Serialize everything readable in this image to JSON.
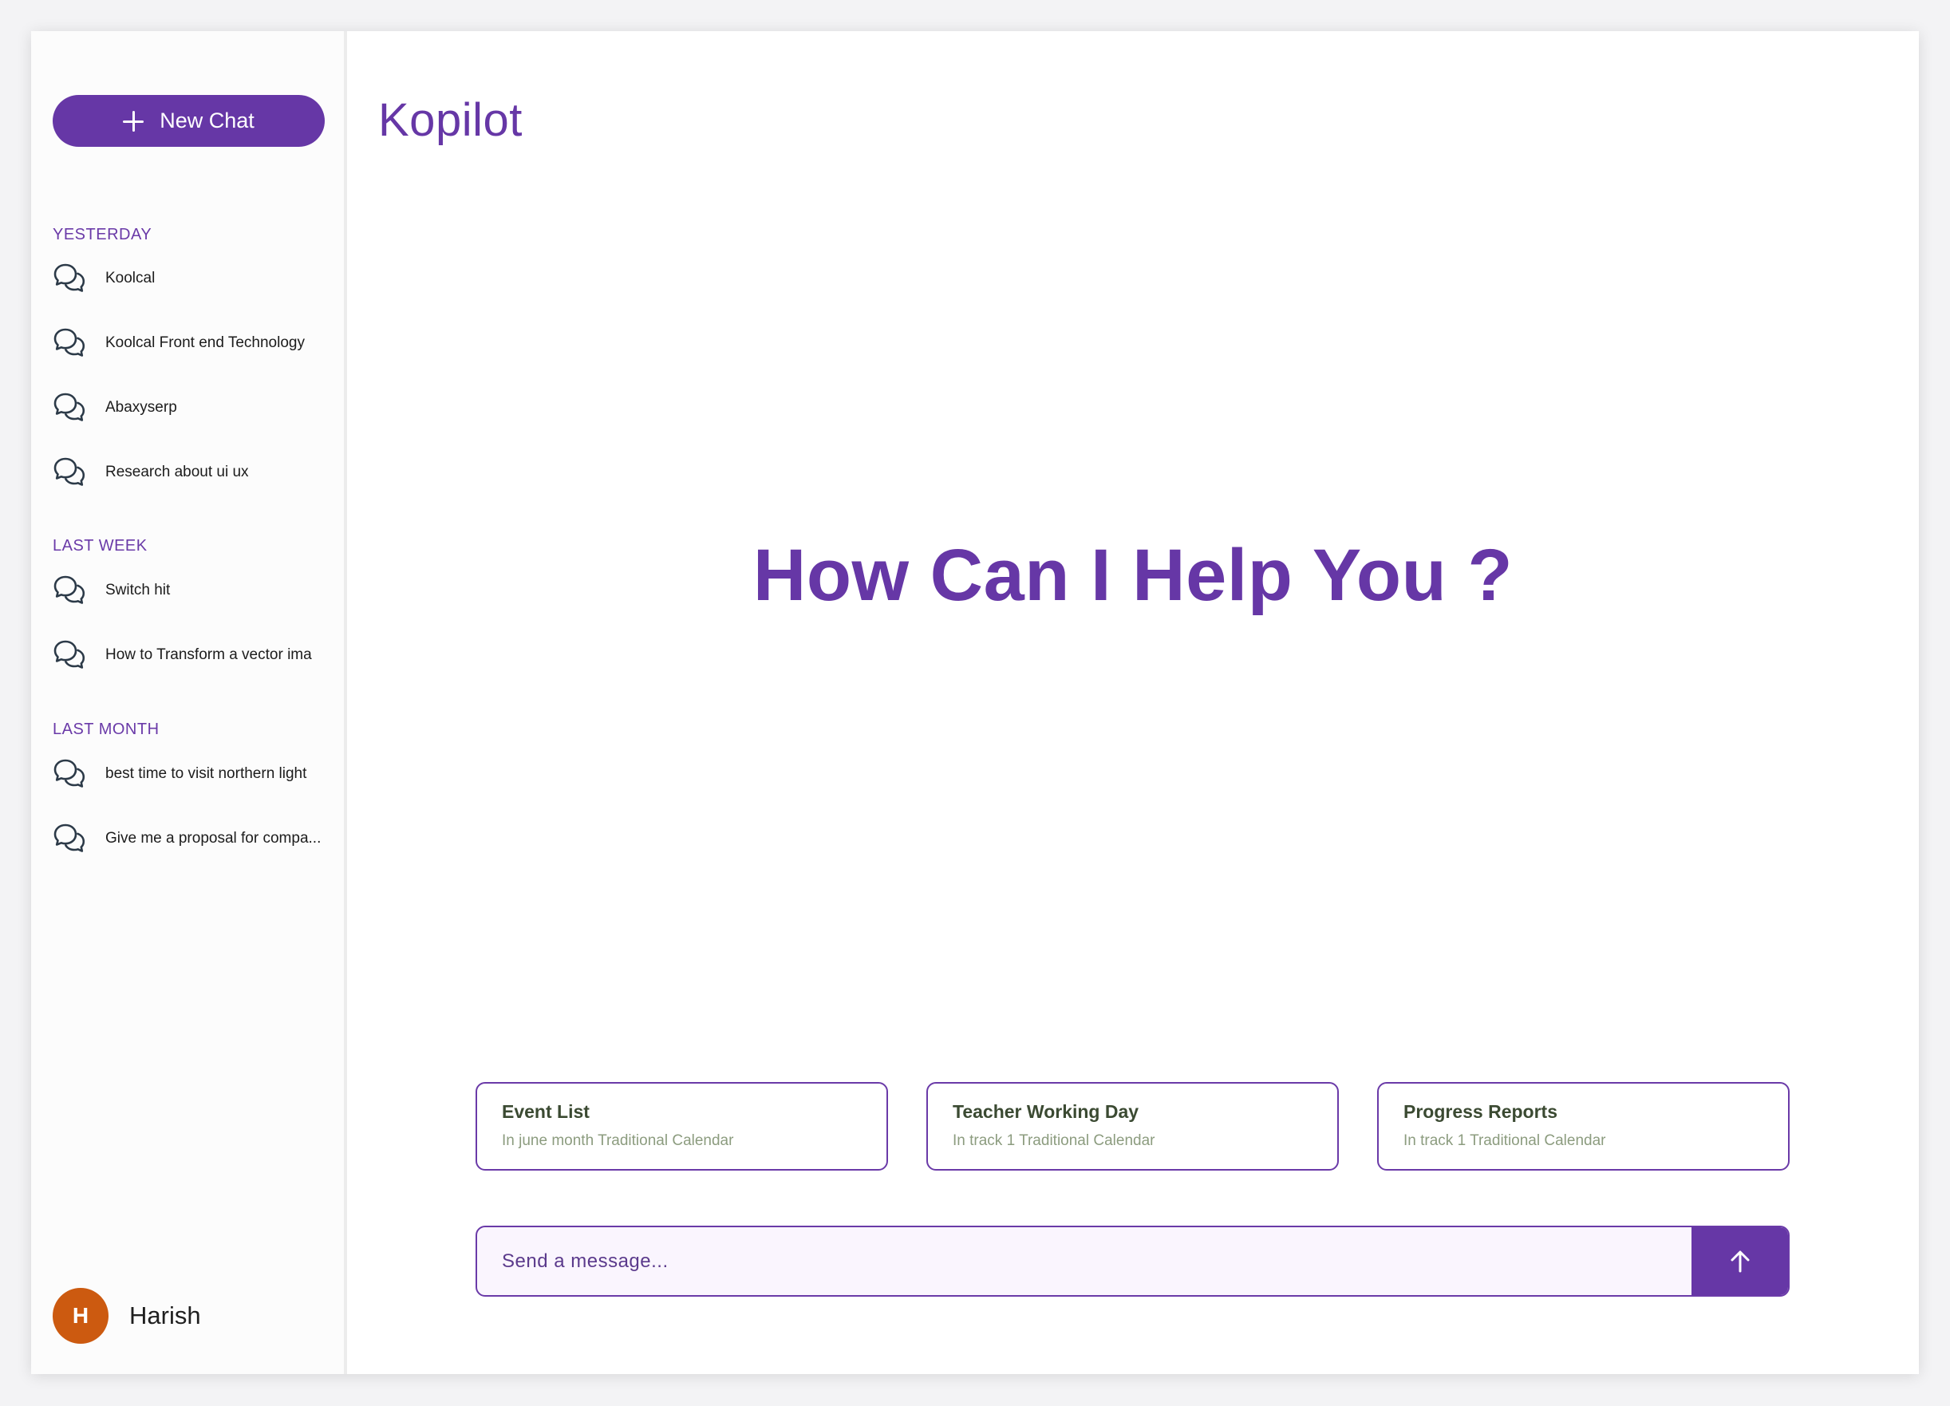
{
  "sidebar": {
    "new_chat_label": "New Chat",
    "sections": [
      {
        "label": "YESTERDAY",
        "items": [
          {
            "label": "Koolcal"
          },
          {
            "label": "Koolcal Front end Technology"
          },
          {
            "label": "Abaxyserp"
          },
          {
            "label": "Research about ui ux"
          }
        ]
      },
      {
        "label": "LAST WEEK",
        "items": [
          {
            "label": "Switch hit"
          },
          {
            "label": "How to Transform a vector ima"
          }
        ]
      },
      {
        "label": "LAST MONTH",
        "items": [
          {
            "label": "best time to visit northern light"
          },
          {
            "label": "Give me a proposal for compa..."
          }
        ]
      }
    ],
    "user": {
      "initial": "H",
      "name": "Harish"
    }
  },
  "main": {
    "app_title": "Kopilot",
    "hero": "How Can I Help You ?",
    "suggestions": [
      {
        "title": "Event List",
        "subtitle": "In june month Traditional Calendar"
      },
      {
        "title": "Teacher Working Day",
        "subtitle": "In track 1 Traditional Calendar"
      },
      {
        "title": "Progress Reports",
        "subtitle": "In track 1 Traditional Calendar"
      }
    ],
    "composer": {
      "placeholder": "Send a message...",
      "value": ""
    }
  },
  "icons": {
    "new_chat": "plus-icon",
    "history_item": "chat-bubbles-icon",
    "send": "arrow-up-icon"
  },
  "colors": {
    "brand": "#6637a6",
    "avatar": "#cc5a10",
    "composer_bg": "#faf5fe"
  }
}
